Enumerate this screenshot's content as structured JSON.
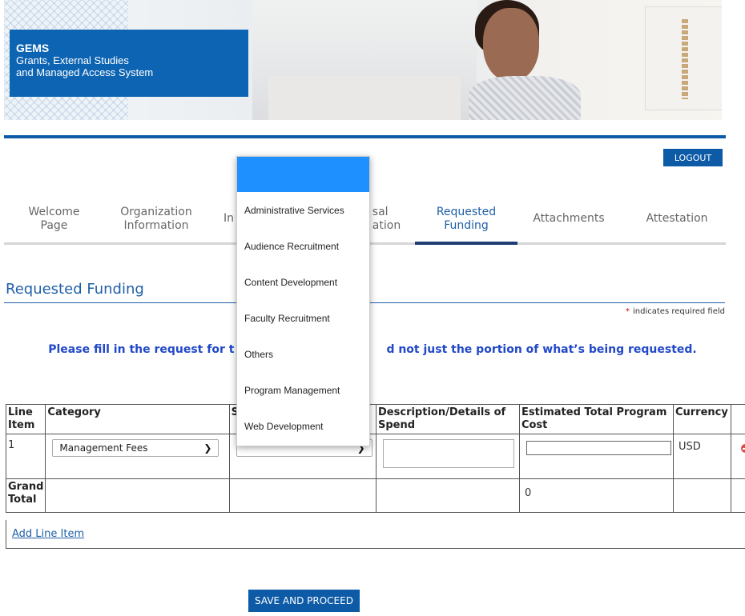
{
  "banner": {
    "title": "GEMS",
    "subtitle_line1": "Grants, External Studies",
    "subtitle_line2": "and Managed Access System"
  },
  "header": {
    "logout_label": "LOGOUT"
  },
  "tabs": [
    {
      "label": "Welcome\nPage"
    },
    {
      "label": "Organization\nInformation"
    },
    {
      "label": "In"
    },
    {
      "label": "sal\nation"
    },
    {
      "label": "Requested\nFunding",
      "active": true
    },
    {
      "label": "Attachments"
    },
    {
      "label": "Attestation"
    }
  ],
  "section": {
    "title": "Requested Funding",
    "required_note": "indicates required field",
    "required_star": "*",
    "instruction_left": "Please fill in the request for t",
    "instruction_right": "d not just the portion of what’s being requested."
  },
  "table": {
    "headers": {
      "line_item": "Line Item",
      "category": "Category",
      "sub": "S",
      "description": "Description/Details of Spend",
      "estimated": "Estimated Total Program Cost",
      "currency": "Currency"
    },
    "rows": [
      {
        "line": "1",
        "category": "Management Fees",
        "subcategory": "",
        "currency": "USD"
      }
    ],
    "grand_total_label": "Grand Total",
    "grand_total_value": "0"
  },
  "actions": {
    "add_line_item": "Add Line Item",
    "save_and_proceed": "SAVE AND PROCEED"
  },
  "dropdown": {
    "options": [
      "Administrative Services",
      "Audience Recruitment",
      "Content Development",
      "Faculty Recruitment",
      "Others",
      "Program Management",
      "Web Development"
    ]
  },
  "colors": {
    "primary_blue": "#0d5aa7",
    "tab_active_text": "#1f5fa8",
    "dropdown_highlight": "#1e90ff",
    "instruction_text": "#2148c9"
  }
}
